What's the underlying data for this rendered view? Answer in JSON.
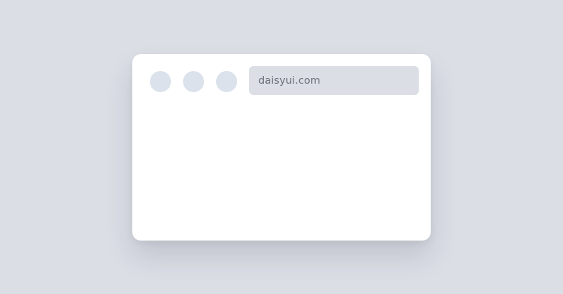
{
  "window": {
    "address_bar": {
      "url": "daisyui.com"
    },
    "controls": [
      {
        "name": "window-control-1"
      },
      {
        "name": "window-control-2"
      },
      {
        "name": "window-control-3"
      }
    ]
  },
  "colors": {
    "page_background": "#dbdee5",
    "window_background": "#ffffff",
    "control_dot": "#dbe2eb",
    "address_bar_background": "#dbdee5",
    "address_text": "#6b7079"
  }
}
